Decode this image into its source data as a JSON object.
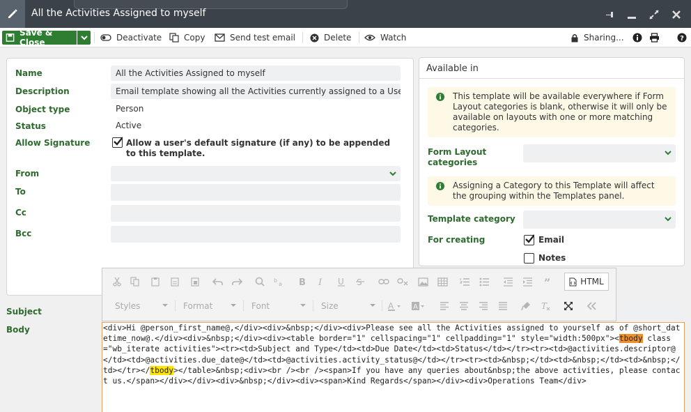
{
  "window": {
    "title": "All the Activities Assigned to myself"
  },
  "toolbar": {
    "save_close": "Save & Close",
    "deactivate": "Deactivate",
    "copy": "Copy",
    "send_test_email": "Send test email",
    "delete": "Delete",
    "watch": "Watch",
    "sharing": "Sharing..."
  },
  "form": {
    "name_label": "Name",
    "name_value": "All the Activities Assigned to myself",
    "description_label": "Description",
    "description_value": "Email template showing all the Activities currently assigned to a Use",
    "object_type_label": "Object type",
    "object_type_value": "Person",
    "status_label": "Status",
    "status_value": "Active",
    "allow_signature_label": "Allow Signature",
    "allow_signature_text": "Allow a user's default signature (if any) to be appended to this template.",
    "from_label": "From",
    "to_label": "To",
    "cc_label": "Cc",
    "bcc_label": "Bcc",
    "subject_label": "Subject",
    "body_label": "Body"
  },
  "available": {
    "header": "Available in",
    "info1": "This template will be available everywhere if Form Layout categories is blank, otherwise it will only be available on layouts with one or more matching categories.",
    "form_layout_label": "Form Layout categories",
    "info2": "Assigning a Category to this Template will affect the grouping within the Templates panel.",
    "template_category_label": "Template category",
    "for_creating_label": "For creating",
    "email_label": "Email",
    "notes_label": "Notes"
  },
  "editor": {
    "styles": "Styles",
    "format": "Format",
    "font": "Font",
    "size": "Size",
    "html_button": "HTML",
    "code_part1": "<div>Hi @person_first_name@,</div><div>&nbsp;</div><div>Please see all the Activities assigned to yourself as of @short_datetime_now@.</div><div>&nbsp;</div><div><table border=\"1\" cellspacing=\"1\" cellpadding=\"1\" style=\"width:500px\"><",
    "code_hl1": "tbody",
    "code_part2": " class=\"wb_iterate activities\"><tr><td>Subject and Type</td><td>Due Date</td><td>Status</td></tr><tr><td>@activities.descriptor@</td><td>@activities.due_date@</td><td>@activities.activity_status@</td></tr><tr><td>&nbsp;</td><td>&nbsp;</td><td>&nbsp;</td></tr></",
    "code_hl2": "tbody",
    "code_part3": "></table>&nbsp;<div><br /><br /><span>If you have any queries about&nbsp;the above activities, please contact us.</span></div></div><div>&nbsp;</div><div><span>Kind Regards</span></div><div>Operations Team</div>"
  },
  "colors": {
    "titlebar": "#3c4249",
    "accent_green": "#2e7d32",
    "label_green": "#2e6b2e"
  }
}
